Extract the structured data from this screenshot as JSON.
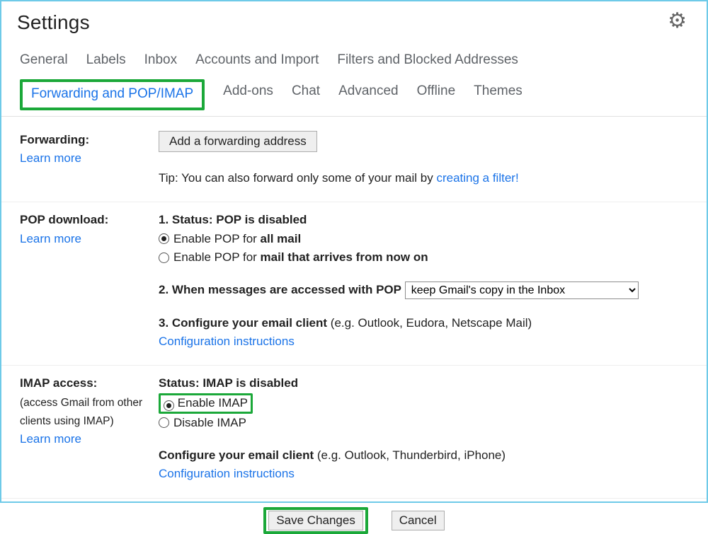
{
  "title": "Settings",
  "tabs": {
    "general": "General",
    "labels": "Labels",
    "inbox": "Inbox",
    "accounts": "Accounts and Import",
    "filters": "Filters and Blocked Addresses",
    "forwarding": "Forwarding and POP/IMAP",
    "addons": "Add-ons",
    "chat": "Chat",
    "advanced": "Advanced",
    "offline": "Offline",
    "themes": "Themes"
  },
  "forwarding": {
    "label": "Forwarding:",
    "learnMore": "Learn more",
    "addButton": "Add a forwarding address",
    "tipPrefix": "Tip: You can also forward only some of your mail by ",
    "tipLink": "creating a filter!",
    "tipSuffix": ""
  },
  "pop": {
    "label": "POP download:",
    "learnMore": "Learn more",
    "l1a": "1. Status: ",
    "l1b": "POP is disabled",
    "r1a": "Enable POP for ",
    "r1b": "all mail",
    "r2a": "Enable POP for ",
    "r2b": "mail that arrives from now on",
    "l2": "2. When messages are accessed with POP",
    "select": "keep Gmail's copy in the Inbox",
    "l3a": "3. Configure your email client",
    "l3b": " (e.g. Outlook, Eudora, Netscape Mail)",
    "confLink": "Configuration instructions"
  },
  "imap": {
    "label": "IMAP access:",
    "sub1": "(access Gmail from other clients using IMAP)",
    "learnMore": "Learn more",
    "statusA": "Status: ",
    "statusB": "IMAP is disabled",
    "r1": "Enable IMAP",
    "r2": "Disable IMAP",
    "confA": "Configure your email client",
    "confB": " (e.g. Outlook, Thunderbird, iPhone)",
    "confLink": "Configuration instructions"
  },
  "footer": {
    "save": "Save Changes",
    "cancel": "Cancel"
  }
}
